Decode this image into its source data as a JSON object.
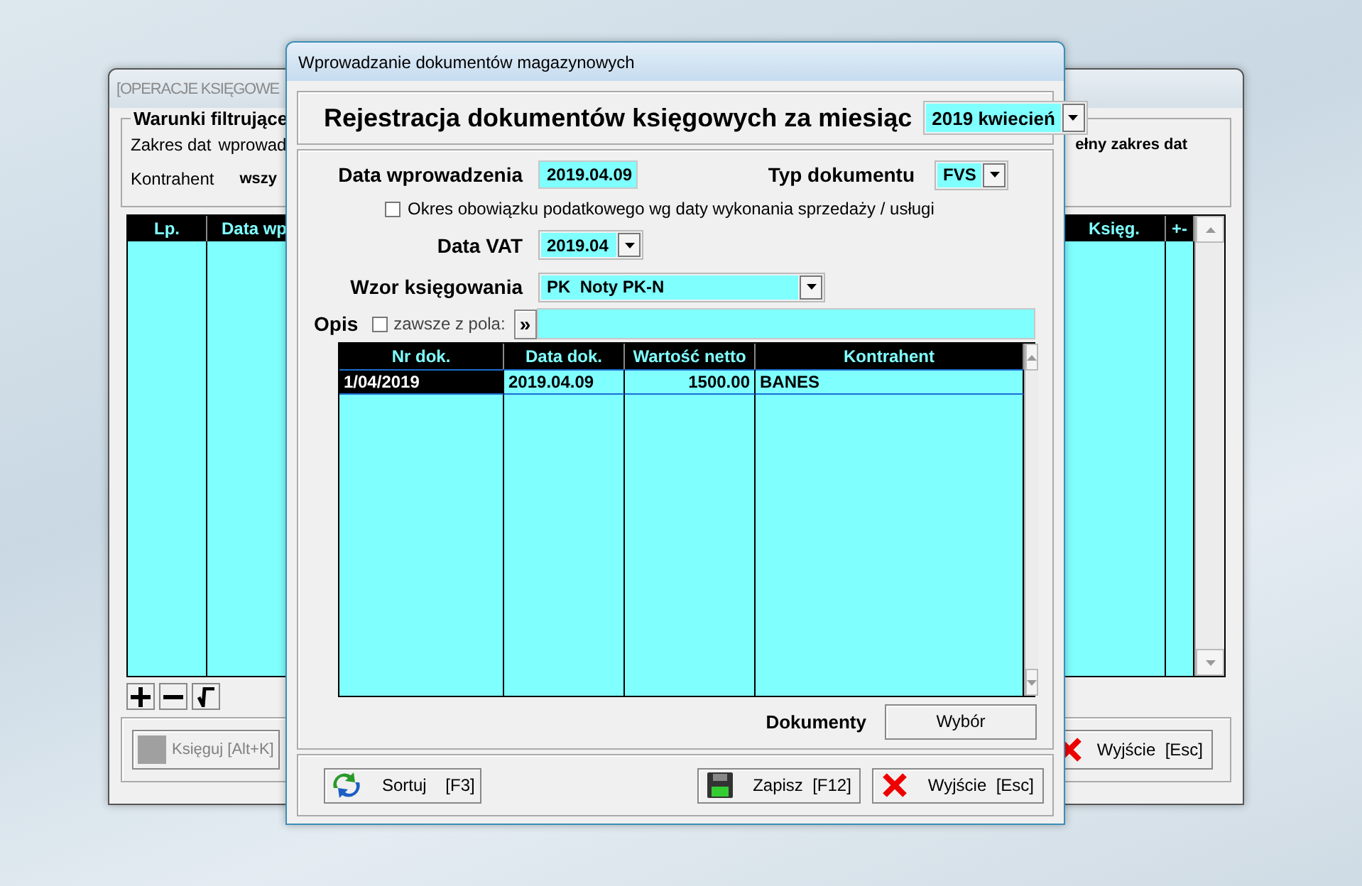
{
  "background_window": {
    "title": "[OPERACJE KSIĘGOWE",
    "filter_group": {
      "title": "Warunki filtrujące",
      "date_label": "Zakres dat",
      "date_value": "wprowad",
      "contractor_label": "Kontrahent",
      "contractor_value": "wszy",
      "date_note": "ełny zakres dat"
    },
    "table": {
      "columns": [
        "Lp.",
        "Data wp",
        "Księg.",
        "+-"
      ]
    },
    "toolbar": [
      {
        "kind": "plus"
      },
      {
        "kind": "minus"
      },
      {
        "kind": "check"
      }
    ],
    "buttons": [
      {
        "label": "Księguj [Alt+K]",
        "kind": "post",
        "disabled": true
      },
      {
        "label": "Wyjście  [Esc]",
        "kind": "exit",
        "disabled": false
      }
    ]
  },
  "dialog": {
    "title": "Wprowadzanie dokumentów magazynowych",
    "heading": "Rejestracja dokumentów księgowych za miesiąc",
    "month": "2019 kwiecień",
    "entry_date_label": "Data wprowadzenia",
    "entry_date": "2019.04.09",
    "doc_type_label": "Typ dokumentu",
    "doc_type": "FVS",
    "tax_period": {
      "label": "Okres obowiązku podatkowego wg daty wykonania sprzedaży / usługi",
      "checked": false
    },
    "vat_date_label": "Data VAT",
    "vat_date": "2019.04",
    "template_label": "Wzor księgowania",
    "template": "PK  Noty PK-N",
    "description_label": "Opis",
    "always_from_field": {
      "label": "zawsze z pola:",
      "checked": false
    },
    "copy_button": "»",
    "table": {
      "columns": [
        "Nr dok.",
        "Data dok.",
        "Wartość netto",
        "Kontrahent"
      ],
      "rows": [
        {
          "cells": [
            "1/04/2019",
            "2019.04.09",
            "1500.00",
            "BANES"
          ],
          "selected": true
        }
      ]
    },
    "documents_label": "Dokumenty",
    "choose_button": "Wybór",
    "buttons": [
      {
        "label": "Sortuj    [F3]",
        "kind": "sort"
      },
      {
        "label": "Zapisz  [F12]",
        "kind": "save"
      },
      {
        "label": "Wyjście  [Esc]",
        "kind": "exit"
      }
    ]
  }
}
